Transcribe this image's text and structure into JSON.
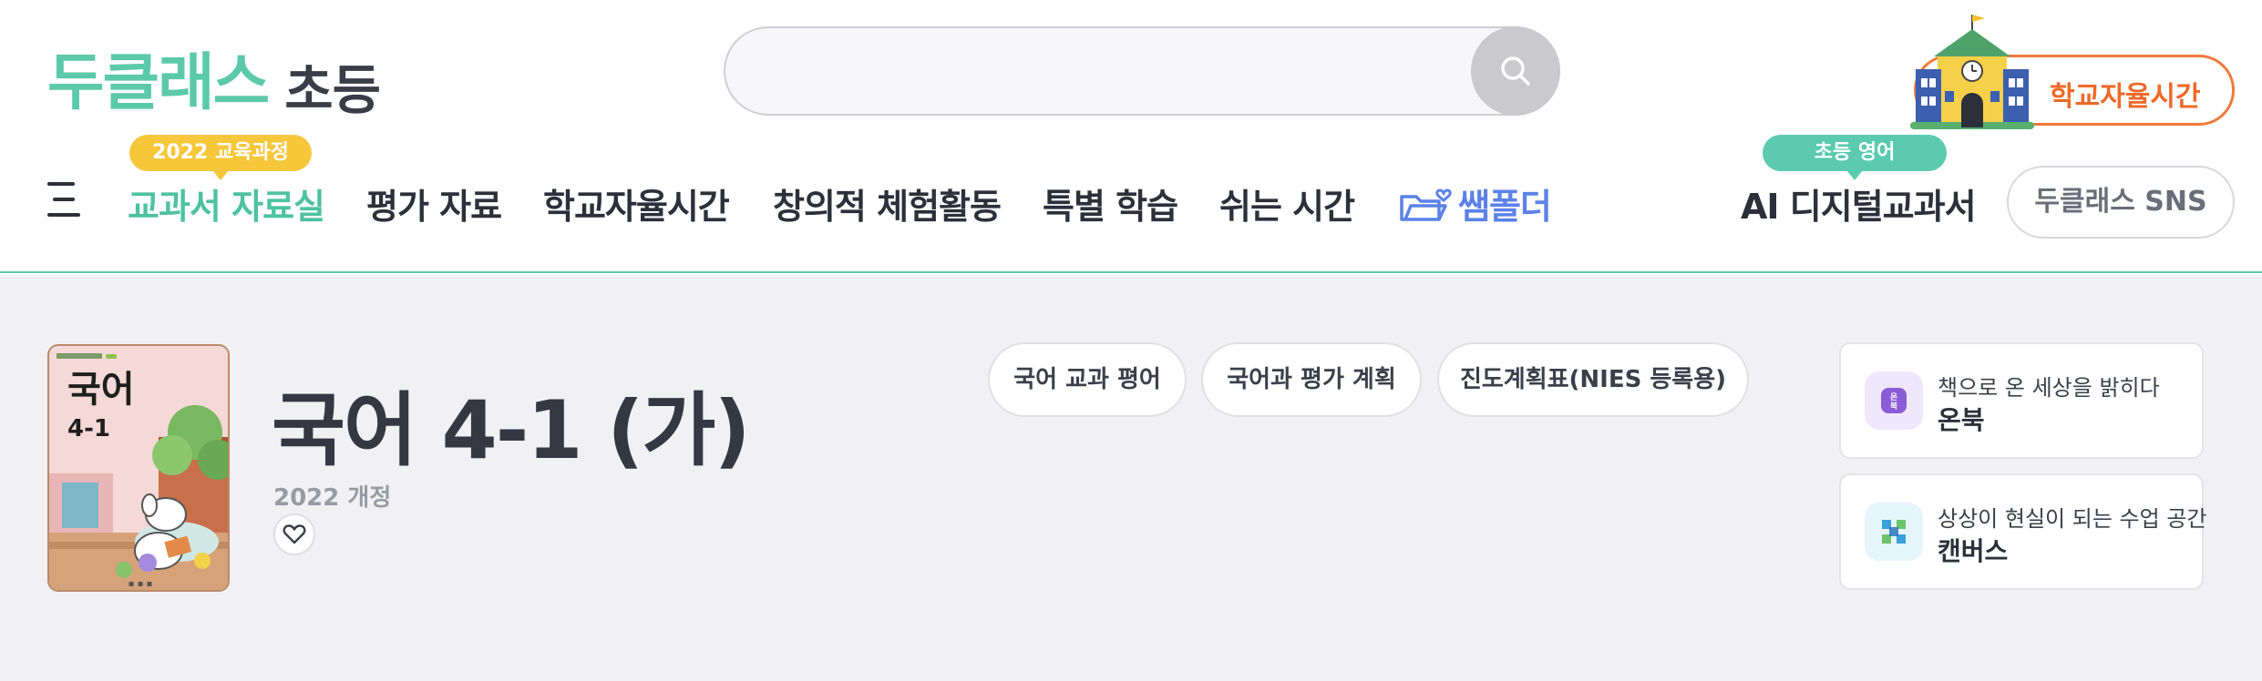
{
  "header": {
    "logo_main": "두클래스",
    "logo_sub": "초등",
    "search_placeholder": "",
    "school_time_button": "학교자율시간",
    "sns_button": "두클래스 SNS"
  },
  "nav": {
    "badge_curriculum": "2022 교육과정",
    "badge_english": "초등 영어",
    "items": [
      {
        "label": "교과서 자료실"
      },
      {
        "label": "평가 자료"
      },
      {
        "label": "학교자율시간"
      },
      {
        "label": "창의적 체험활동"
      },
      {
        "label": "특별 학습"
      },
      {
        "label": "쉬는 시간"
      },
      {
        "label": "쌤폴더"
      },
      {
        "label": "AI 디지털교과서"
      }
    ]
  },
  "textbook": {
    "cover_title": "국어",
    "cover_grade": "4-1",
    "title": "국어 4-1 (가)",
    "edition": "2022 개정"
  },
  "actions": [
    {
      "label": "국어 교과 평어"
    },
    {
      "label": "국어과 평가 계획"
    },
    {
      "label": "진도계획표(NIES 등록용)"
    }
  ],
  "cards": [
    {
      "subtitle": "책으로 온 세상을 밝히다",
      "title": "온북",
      "icon": "onbook-icon",
      "icon_bg": "#efe7fb",
      "icon_color": "#8b5cd6"
    },
    {
      "subtitle": "상상이 현실이 되는 수업 공간",
      "title": "캔버스",
      "icon": "canvas-icon",
      "icon_bg": "#e6f4fb",
      "icon_color": "#3aa0d8"
    }
  ],
  "colors": {
    "brand_green": "#5ccaa8",
    "accent_orange": "#ee6a2a",
    "folder_blue": "#5c82e8",
    "badge_yellow": "#f7c73b"
  }
}
